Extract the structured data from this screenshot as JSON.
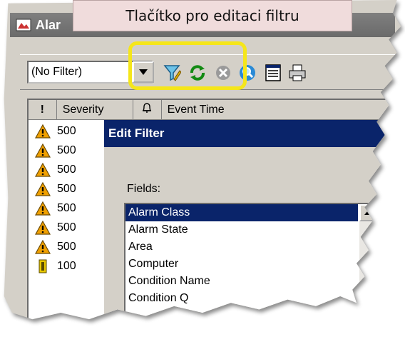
{
  "callout": {
    "text": "Tlačítko pro editaci filtru"
  },
  "window": {
    "title": "Alar"
  },
  "toolbar": {
    "filter_value": "(No Filter)",
    "buttons": [
      "dropdown-icon",
      "edit-filter-icon",
      "refresh-icon",
      "stop-icon",
      "find-icon",
      "properties-icon",
      "print-icon"
    ]
  },
  "list": {
    "headers": [
      "!",
      "Severity",
      "🔔",
      "Event Time"
    ],
    "rows": [
      {
        "icon": "warning-icon",
        "severity": "500"
      },
      {
        "icon": "warning-icon",
        "severity": "500"
      },
      {
        "icon": "warning-icon",
        "severity": "500"
      },
      {
        "icon": "warning-icon",
        "severity": "500"
      },
      {
        "icon": "warning-icon",
        "severity": "500"
      },
      {
        "icon": "warning-icon",
        "severity": "500"
      },
      {
        "icon": "warning-icon",
        "severity": "500"
      },
      {
        "icon": "info-icon",
        "severity": "100"
      }
    ]
  },
  "dialog": {
    "title": "Edit Filter",
    "fields_label": "Fields:",
    "fields": [
      "Alarm Class",
      "Alarm State",
      "Area",
      "Computer",
      "Condition Name",
      "Condition Q"
    ],
    "selected_index": 0
  },
  "colors": {
    "highlight": "#f5e61a",
    "selection": "#0a246a",
    "callout_bg": "#f0dcdc",
    "warning": "#f0a000"
  }
}
